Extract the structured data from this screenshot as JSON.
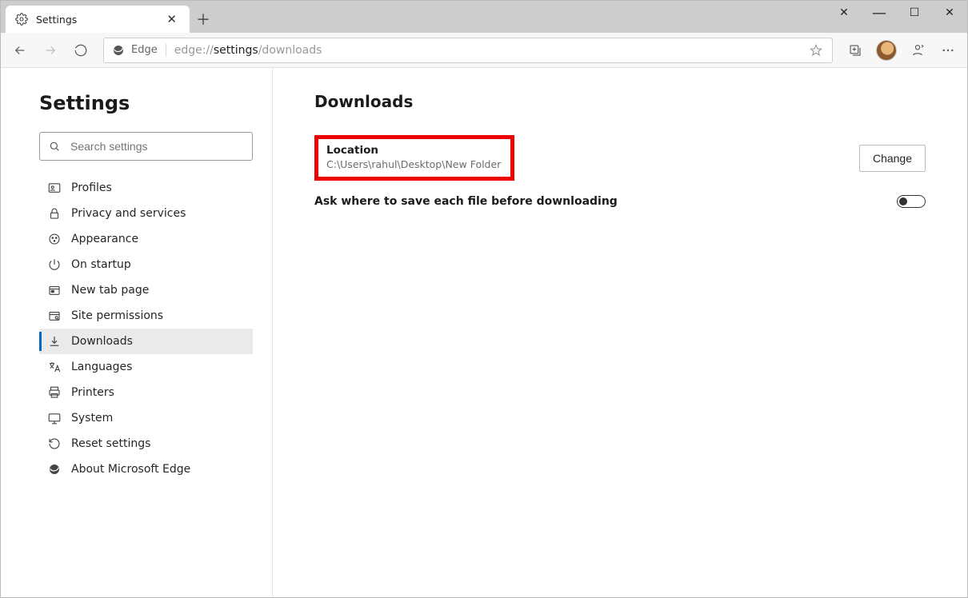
{
  "tab": {
    "title": "Settings"
  },
  "toolbar": {
    "identity_label": "Edge",
    "url_prefix": "edge://",
    "url_strong": "settings",
    "url_suffix": "/downloads"
  },
  "sidebar": {
    "title": "Settings",
    "search_placeholder": "Search settings",
    "items": [
      {
        "label": "Profiles",
        "icon": "profile-card-icon"
      },
      {
        "label": "Privacy and services",
        "icon": "lock-icon"
      },
      {
        "label": "Appearance",
        "icon": "appearance-icon"
      },
      {
        "label": "On startup",
        "icon": "power-icon"
      },
      {
        "label": "New tab page",
        "icon": "new-tab-icon"
      },
      {
        "label": "Site permissions",
        "icon": "permissions-icon"
      },
      {
        "label": "Downloads",
        "icon": "download-icon",
        "selected": true
      },
      {
        "label": "Languages",
        "icon": "languages-icon"
      },
      {
        "label": "Printers",
        "icon": "printer-icon"
      },
      {
        "label": "System",
        "icon": "system-icon"
      },
      {
        "label": "Reset settings",
        "icon": "reset-icon"
      },
      {
        "label": "About Microsoft Edge",
        "icon": "edge-icon"
      }
    ]
  },
  "main": {
    "heading": "Downloads",
    "location_label": "Location",
    "location_path": "C:\\Users\\rahul\\Desktop\\New Folder",
    "change_button": "Change",
    "ask_toggle_label": "Ask where to save each file before downloading",
    "ask_toggle_on": false
  }
}
